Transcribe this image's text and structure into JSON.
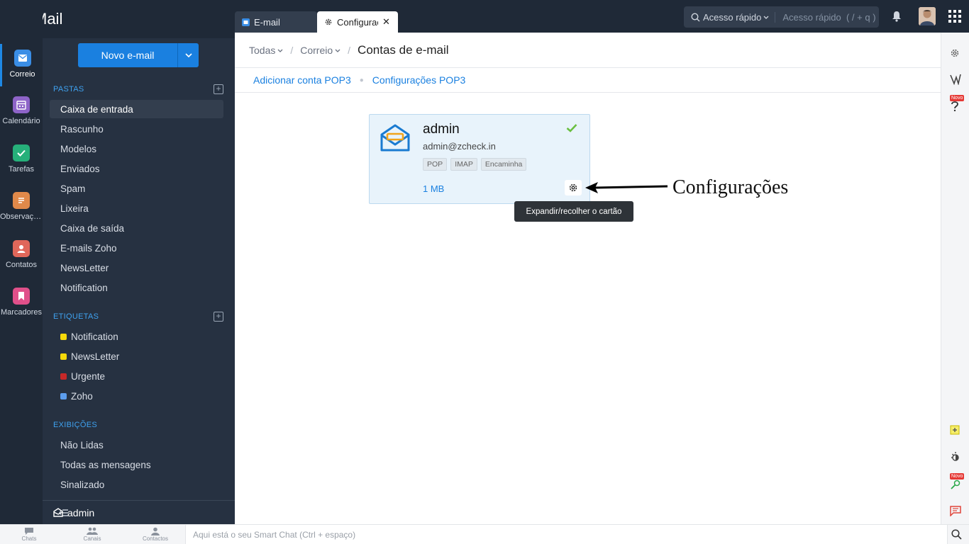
{
  "app": {
    "title": "Mail"
  },
  "rail": [
    {
      "label": "Correio",
      "icon": "mail-icon",
      "color": "#3a8ee6"
    },
    {
      "label": "Calendário",
      "icon": "calendar-icon",
      "color": "#8e64c8"
    },
    {
      "label": "Tarefas",
      "icon": "check-icon",
      "color": "#26b07a"
    },
    {
      "label": "Observações",
      "icon": "note-icon",
      "color": "#e0894a"
    },
    {
      "label": "Contatos",
      "icon": "contact-icon",
      "color": "#e0675a"
    },
    {
      "label": "Marcadores",
      "icon": "bookmark-icon",
      "color": "#e0508a"
    }
  ],
  "panel": {
    "new_mail": "Novo e-mail",
    "folders_title": "PASTAS",
    "folders": [
      "Caixa de entrada",
      "Rascunho",
      "Modelos",
      "Enviados",
      "Spam",
      "Lixeira",
      "Caixa de saída",
      "E-mails Zoho",
      "NewsLetter",
      "Notification"
    ],
    "tags_title": "ETIQUETAS",
    "tags": [
      {
        "label": "Notification",
        "color": "#f5d90a"
      },
      {
        "label": "NewsLetter",
        "color": "#f5d90a"
      },
      {
        "label": "Urgente",
        "color": "#c62828"
      },
      {
        "label": "Zoho",
        "color": "#5c9ded"
      }
    ],
    "views_title": "EXIBIÇÕES",
    "views": [
      "Não Lidas",
      "Todas as mensagens",
      "Sinalizado"
    ],
    "account": "admin"
  },
  "tabs": [
    {
      "label": "E-mail"
    },
    {
      "label": "Configurações"
    }
  ],
  "search": {
    "scope": "Acesso rápido",
    "placeholder": "Acesso rápido  ( / + q )"
  },
  "breadcrumb": {
    "item1": "Todas",
    "item2": "Correio",
    "current": "Contas de e-mail"
  },
  "sublinks": {
    "add_pop3": "Adicionar conta POP3",
    "pop3_settings": "Configurações POP3"
  },
  "account_card": {
    "name": "admin",
    "email": "admin@zcheck.in",
    "tags": [
      "POP",
      "IMAP",
      "Encaminha"
    ],
    "size": "1 MB"
  },
  "tooltip": "Expandir/recolher o cartão",
  "annotation": "Configurações",
  "right_sidebar": {
    "new_badge": "Novo"
  },
  "bottom": {
    "chats": "Chats",
    "channels": "Canais",
    "contacts": "Contactos",
    "chat_placeholder": "Aqui está o seu Smart Chat (Ctrl + espaço)"
  }
}
